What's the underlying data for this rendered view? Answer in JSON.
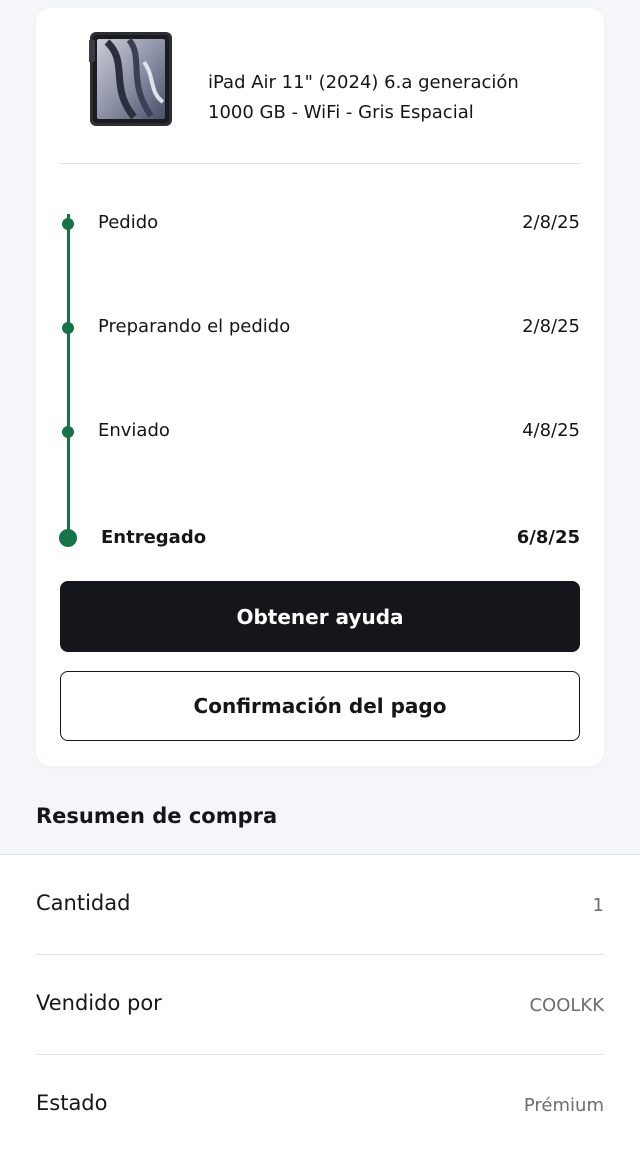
{
  "product": {
    "name_line1": "iPad Air 11\" (2024) 6.a generación",
    "name_line2": "1000 GB - WiFi - Gris Espacial",
    "image_icon": "ipad-product-image"
  },
  "timeline": {
    "steps": [
      {
        "label": "Pedido",
        "date": "2/8/25"
      },
      {
        "label": "Preparando el pedido",
        "date": "2/8/25"
      },
      {
        "label": "Enviado",
        "date": "4/8/25"
      },
      {
        "label": "Entregado",
        "date": "6/8/25"
      }
    ],
    "accent_color": "#17734a"
  },
  "actions": {
    "help_label": "Obtener ayuda",
    "payment_label": "Confirmación del pago"
  },
  "summary": {
    "title": "Resumen de compra",
    "rows": [
      {
        "label": "Cantidad",
        "value": "1"
      },
      {
        "label": "Vendido por",
        "value": "COOLKK"
      },
      {
        "label": "Estado",
        "value": "Prémium"
      }
    ]
  }
}
